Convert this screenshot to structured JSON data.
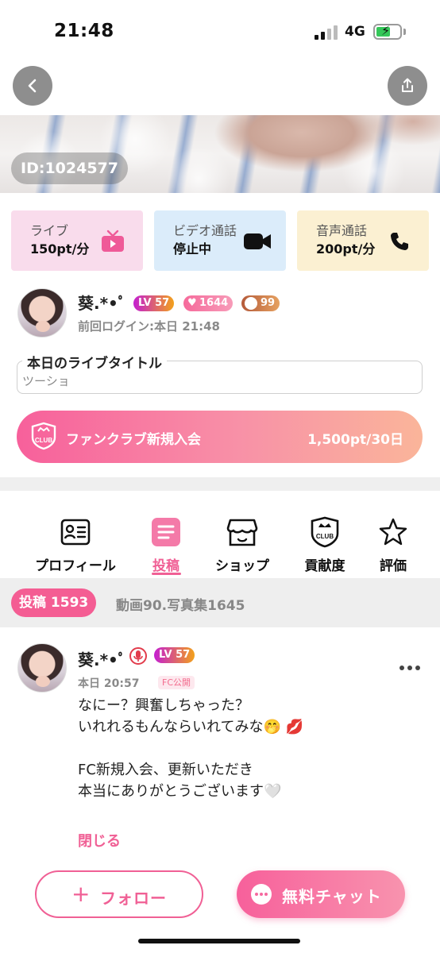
{
  "status_bar": {
    "time": "21:48",
    "network": "4G"
  },
  "profile": {
    "id_label": "ID:1024577",
    "name": "葵.*•ﾟ",
    "level": "LV 57",
    "hearts": "1644",
    "club_count": "99",
    "last_login": "前回ログイン:本日 21:48"
  },
  "cards": [
    {
      "label": "ライブ",
      "value": "150pt/分"
    },
    {
      "label": "ビデオ通話",
      "value": "停止中"
    },
    {
      "label": "音声通話",
      "value": "200pt/分"
    }
  ],
  "live_title": {
    "legend": "本日のライブタイトル",
    "value": "ツーショ"
  },
  "fanclub": {
    "label": "ファンクラブ新規入会",
    "price": "1,500pt/30日",
    "badge": "CLUB"
  },
  "tabs": [
    {
      "label": "プロフィール",
      "icon": "profile-card-icon"
    },
    {
      "label": "投稿",
      "icon": "posts-icon"
    },
    {
      "label": "ショップ",
      "icon": "shop-icon"
    },
    {
      "label": "貢献度",
      "icon": "club-crown-icon"
    },
    {
      "label": "評価",
      "icon": "star-icon"
    }
  ],
  "filters": {
    "active": "投稿 1593",
    "other": "動画90.写真集1645"
  },
  "post": {
    "name": "葵.*•ﾟ",
    "level": "LV 57",
    "time": "本日 20:57",
    "tag": "FC公開",
    "lines": [
      "なにー？興奮しちゃった？",
      "いれれるもんならいれてみな🤭 💋",
      "",
      "FC新規入会、更新いただき",
      "本当にありがとうございます🤍"
    ],
    "close_label": "閉じる"
  },
  "bottom": {
    "follow_label": "フォロー",
    "chat_label": "無料チャット"
  },
  "colors": {
    "accent": "#f06095",
    "live_card": "#f9dcec",
    "video_card": "#dbecfa",
    "voice_card": "#fbf0d2"
  }
}
